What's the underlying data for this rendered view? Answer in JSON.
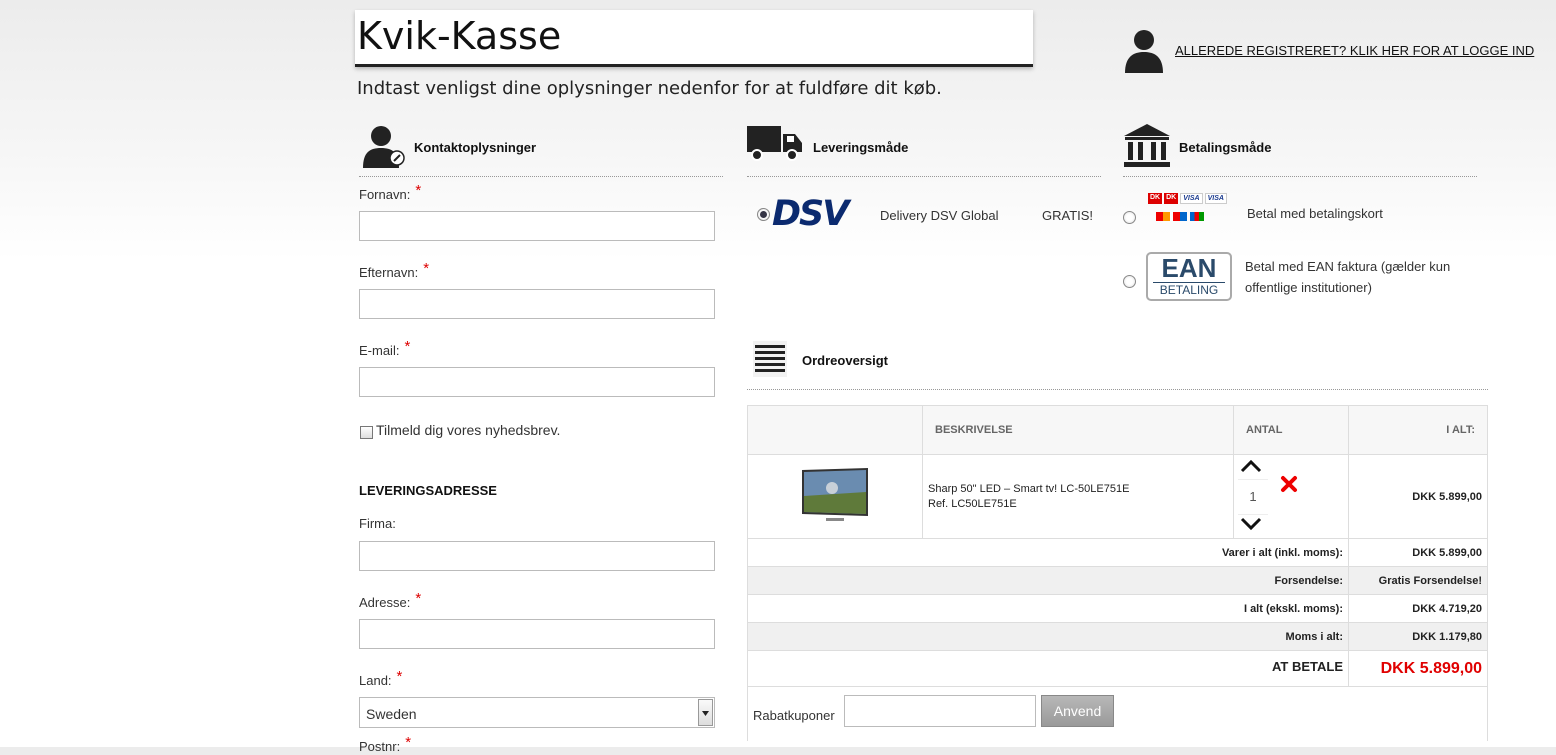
{
  "header": {
    "title": "Kvik-Kasse",
    "subtitle": "Indtast venligst dine oplysninger nedenfor for at fuldføre dit køb.",
    "login_link": "ALLEREDE REGISTRERET? KLIK HER FOR AT LOGGE IND"
  },
  "contact": {
    "heading": "Kontaktoplysninger",
    "first_name_label": "Fornavn:",
    "last_name_label": "Efternavn:",
    "email_label": "E-mail:",
    "newsletter_label": "Tilmeld dig vores nyhedsbrev.",
    "required_mark": "*"
  },
  "delivery_address": {
    "heading": "LEVERINGSADRESSE",
    "company_label": "Firma:",
    "address_label": "Adresse:",
    "country_label": "Land:",
    "country_value": "Sweden",
    "postal_label": "Postnr:"
  },
  "shipping": {
    "heading": "Leveringsmåde",
    "logo_text": "DSV",
    "method": "Delivery DSV Global",
    "price": "GRATIS!"
  },
  "payment": {
    "heading": "Betalingsmåde",
    "card_label": "Betal med betalingskort",
    "ean_line1": "Betal med EAN faktura (gælder kun",
    "ean_line2": "offentlige institutioner)",
    "ean_logo_top": "EAN",
    "ean_logo_bottom": "BETALING",
    "card_logos": [
      "DK",
      "DK",
      "VISA",
      "VISA"
    ]
  },
  "order": {
    "heading": "Ordreoversigt",
    "columns": [
      "BESKRIVELSE",
      "ANTAL",
      "I ALT:"
    ],
    "item": {
      "name": "Sharp 50\" LED – Smart tv! LC-50LE751E",
      "ref": "Ref. LC50LE751E",
      "quantity": "1",
      "total": "DKK 5.899,00"
    },
    "summary": [
      {
        "label": "Varer i alt (inkl. moms):",
        "value": "DKK 5.899,00"
      },
      {
        "label": "Forsendelse:",
        "value": "Gratis Forsendelse!"
      },
      {
        "label": "I alt (ekskl. moms):",
        "value": "DKK 4.719,20"
      },
      {
        "label": "Moms i alt:",
        "value": "DKK 1.179,80"
      }
    ],
    "to_pay_label": "AT BETALE",
    "to_pay_value": "DKK 5.899,00",
    "coupon_label": "Rabatkuponer",
    "apply_button": "Anvend"
  },
  "colors": {
    "accent_red": "#e00000",
    "dsv_blue": "#0b2a6f"
  }
}
